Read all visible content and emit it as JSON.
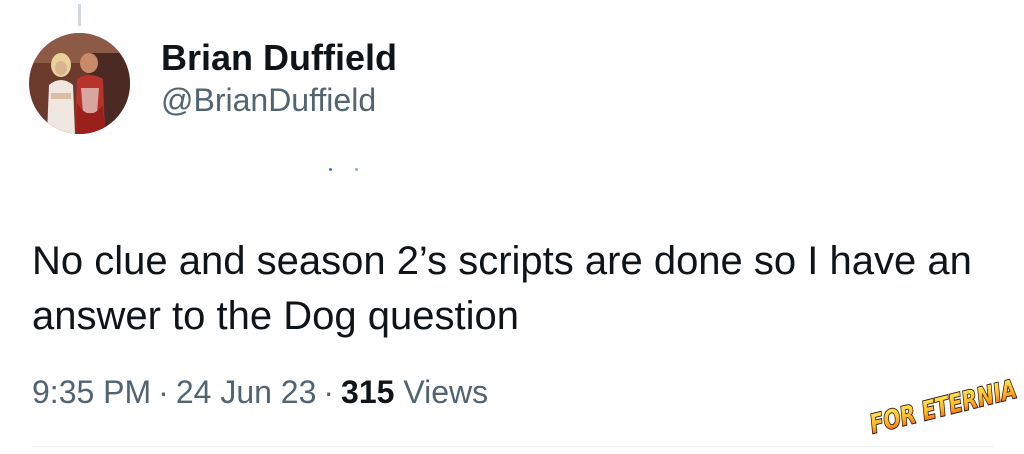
{
  "tweet": {
    "author": {
      "display_name": "Brian Duffield",
      "handle": "@BrianDuffield"
    },
    "text": "No clue and season 2’s scripts are done so I have an answer to the Dog question",
    "meta": {
      "time": "9:35 PM",
      "separator": "·",
      "date": "24 Jun 23",
      "views_count": "315",
      "views_label": "Views"
    }
  },
  "watermark": {
    "text": "FOR ETERNIA"
  },
  "colors": {
    "text_primary": "#0f1419",
    "text_secondary": "#536471",
    "divider": "#eff3f4",
    "thread_line": "#cfd9de"
  }
}
